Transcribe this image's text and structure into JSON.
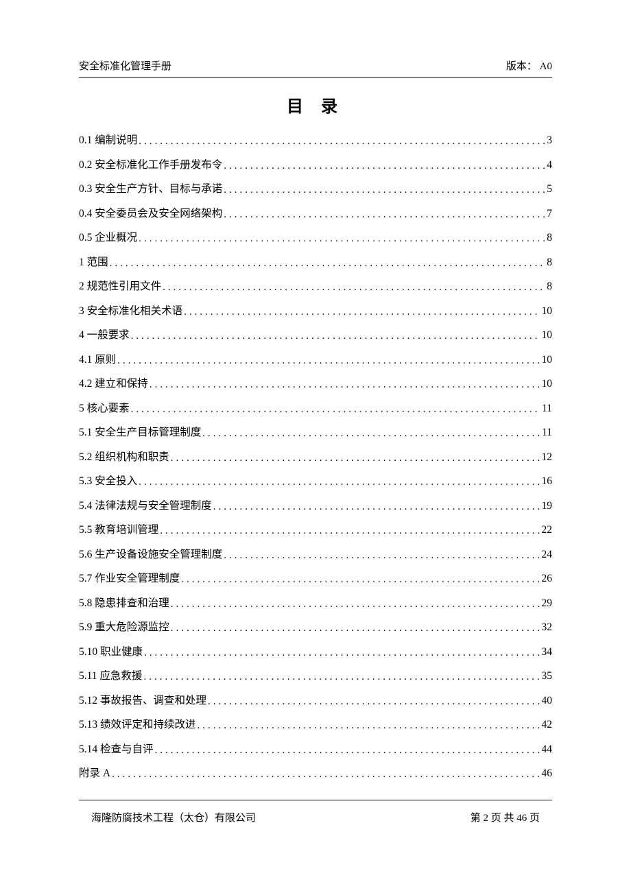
{
  "header": {
    "left": "安全标准化管理手册",
    "right": "版本： A0"
  },
  "title": "目 录",
  "toc": [
    {
      "label": "0.1 编制说明",
      "page": "3"
    },
    {
      "label": "0.2 安全标准化工作手册发布令",
      "page": "4"
    },
    {
      "label": "0.3 安全生产方针、目标与承诺",
      "page": "5"
    },
    {
      "label": "0.4 安全委员会及安全网络架构",
      "page": "7"
    },
    {
      "label": "0.5 企业概况",
      "page": "8"
    },
    {
      "label": "1 范围",
      "page": "8"
    },
    {
      "label": "2 规范性引用文件",
      "page": "8"
    },
    {
      "label": "3 安全标准化相关术语",
      "page": "10"
    },
    {
      "label": "4  一般要求",
      "page": "10"
    },
    {
      "label": "4.1  原则",
      "page": "10"
    },
    {
      "label": "4.2  建立和保持",
      "page": "10"
    },
    {
      "label": "5 核心要素",
      "page": "11"
    },
    {
      "label": "5.1 安全生产目标管理制度",
      "page": "11"
    },
    {
      "label": "5.2  组织机构和职责",
      "page": "12"
    },
    {
      "label": "5.3 安全投入",
      "page": "16"
    },
    {
      "label": "5.4   法律法规与安全管理制度",
      "page": "19"
    },
    {
      "label": "5.5   教育培训管理",
      "page": "22"
    },
    {
      "label": "5.6   生产设备设施安全管理制度",
      "page": "24"
    },
    {
      "label": "5.7   作业安全管理制度",
      "page": "26"
    },
    {
      "label": "5.8  隐患排查和治理",
      "page": "29"
    },
    {
      "label": "5.9  重大危险源监控",
      "page": "32"
    },
    {
      "label": "5.10   职业健康",
      "page": "34"
    },
    {
      "label": "5.11   应急救援",
      "page": "35"
    },
    {
      "label": "5.12  事故报告、调查和处理",
      "page": "40"
    },
    {
      "label": "5.13  绩效评定和持续改进",
      "page": "42"
    },
    {
      "label": "5.14  检查与自评",
      "page": "44"
    },
    {
      "label": "附录 A",
      "page": "46"
    }
  ],
  "footer": {
    "left": "海隆防腐技术工程（太仓）有限公司",
    "right": "第 2 页 共 46 页"
  }
}
